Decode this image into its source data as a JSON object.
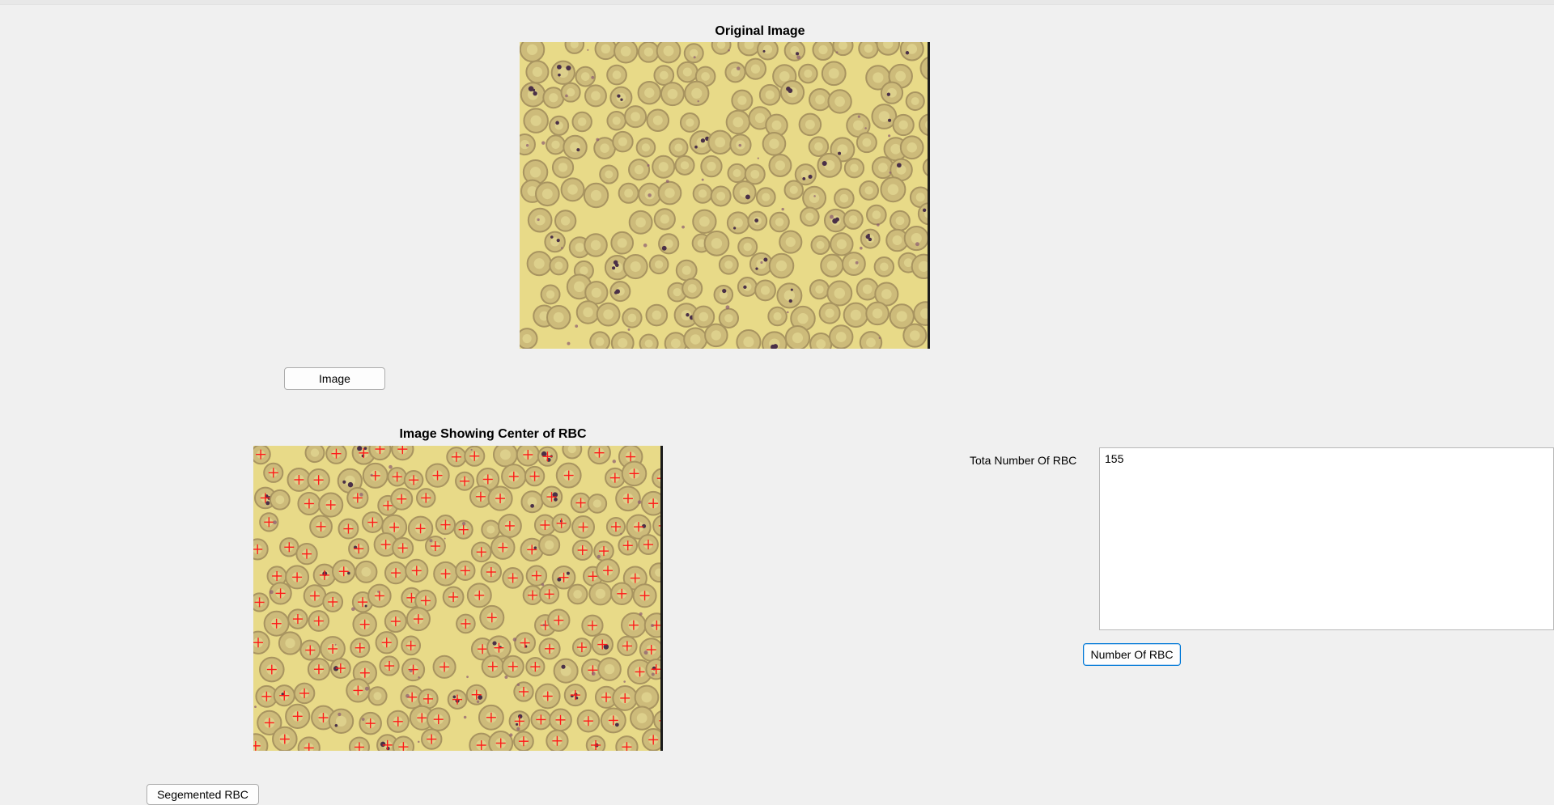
{
  "axes": {
    "original": {
      "title": "Original Image"
    },
    "centers": {
      "title": "Image Showing Center of RBC"
    }
  },
  "buttons": {
    "image": "Image",
    "count": "Number Of RBC",
    "segmented": "Segemented RBC"
  },
  "result": {
    "label": "Tota Number Of RBC",
    "value": "155"
  },
  "colors": {
    "background": "#f0f0f0",
    "smear_background": "#e8da88",
    "cell_fill": "#cdbb7a",
    "cell_ring": "#a89460",
    "cell_center": "#ddd08c",
    "parasite": "#4a3048",
    "marker": "#ff1a1a",
    "focus_border": "#0078d7"
  }
}
